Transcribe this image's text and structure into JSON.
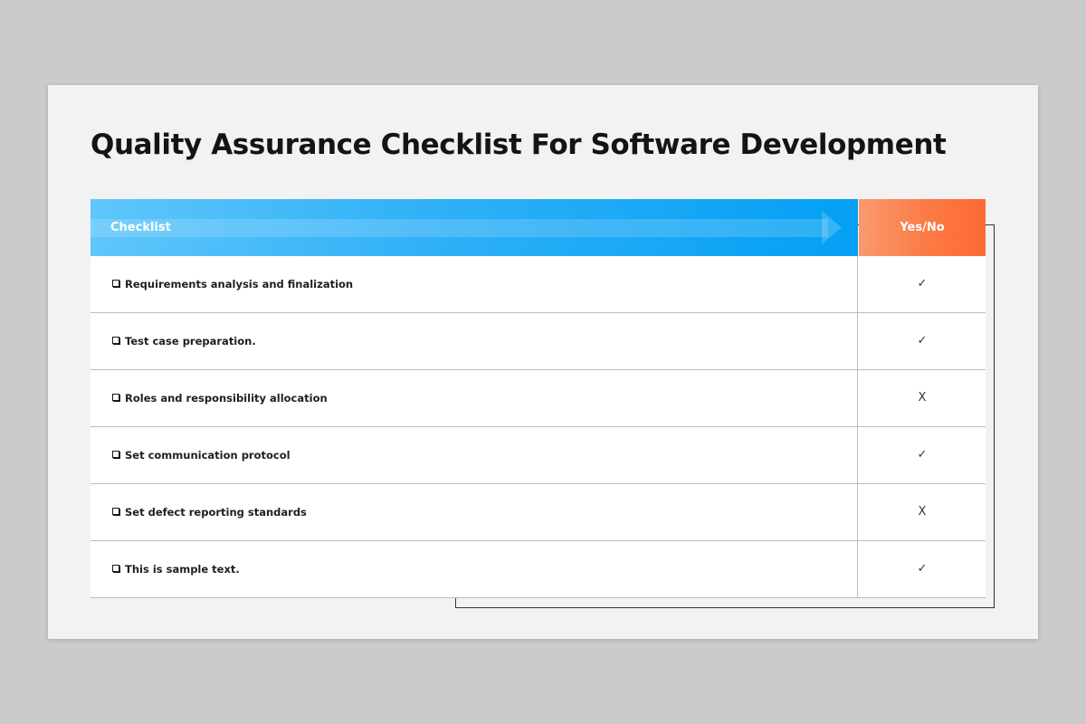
{
  "slide": {
    "title": "Quality Assurance Checklist For Software Development",
    "colors": {
      "header_blue": "#04a0f4",
      "header_orange": "#fc6a34",
      "background": "#f2f2f2"
    }
  },
  "table": {
    "headers": {
      "checklist": "Checklist",
      "yes_no": "Yes/No"
    },
    "rows": [
      {
        "item": "Requirements analysis and finalization",
        "mark": "✓"
      },
      {
        "item": "Test case preparation.",
        "mark": "✓"
      },
      {
        "item": "Roles and responsibility allocation",
        "mark": "X"
      },
      {
        "item": "Set communication protocol",
        "mark": "✓"
      },
      {
        "item": "Set defect reporting standards",
        "mark": "X"
      },
      {
        "item": "This is sample text.",
        "mark": "✓"
      }
    ]
  }
}
